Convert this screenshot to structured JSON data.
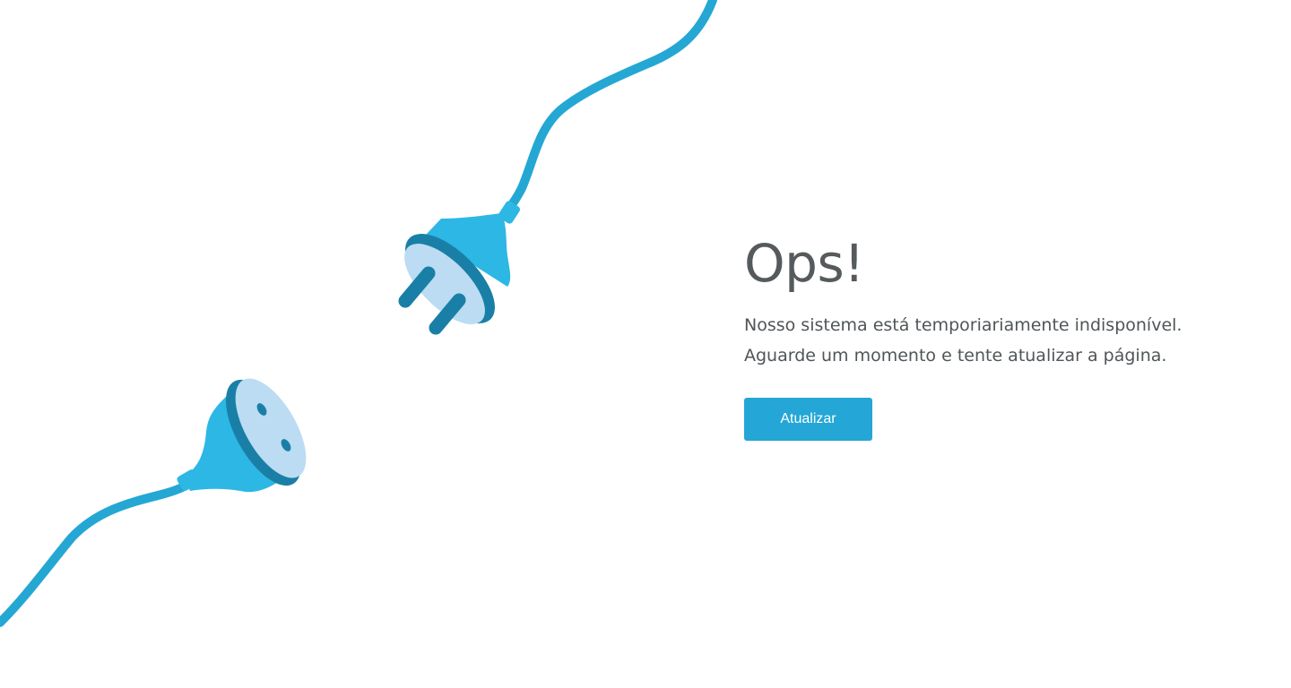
{
  "error": {
    "title": "Ops!",
    "message_lines": [
      "Nosso sistema está temporiariamente indisponível.",
      "Aguarde um momento e tente atualizar a página."
    ],
    "refresh_button_label": "Atualizar"
  },
  "illustration": {
    "icons": [
      "plug-icon",
      "socket-icon"
    ],
    "colors": {
      "cable": "#25a7d4",
      "plug_body": "#2db7e5",
      "plug_rim": "#1a7fa6",
      "plug_face": "#bbdcf2"
    }
  },
  "theme": {
    "accent": "#24a6d6",
    "text": "#555a5c",
    "background": "#ffffff"
  }
}
